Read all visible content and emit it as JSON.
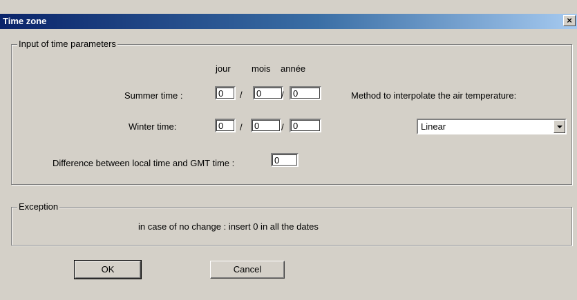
{
  "window": {
    "title": "Time zone",
    "close_label": "×"
  },
  "time_params": {
    "legend": "Input of time parameters",
    "col_day": "jour",
    "col_month": "mois",
    "col_year": "année",
    "summer_label": "Summer time :",
    "winter_label": "Winter time:",
    "summer": {
      "day": "0",
      "month": "0",
      "year": "0"
    },
    "winter": {
      "day": "0",
      "month": "0",
      "year": "0"
    },
    "separator": "/",
    "gmt_label": "Difference between local time and GMT time :",
    "gmt_value": "0",
    "method_label": "Method to interpolate the air temperature:",
    "method_value": "Linear"
  },
  "exception": {
    "legend": "Exception",
    "text": "in case of no change : insert 0 in all the dates"
  },
  "buttons": {
    "ok": "OK",
    "cancel": "Cancel"
  }
}
